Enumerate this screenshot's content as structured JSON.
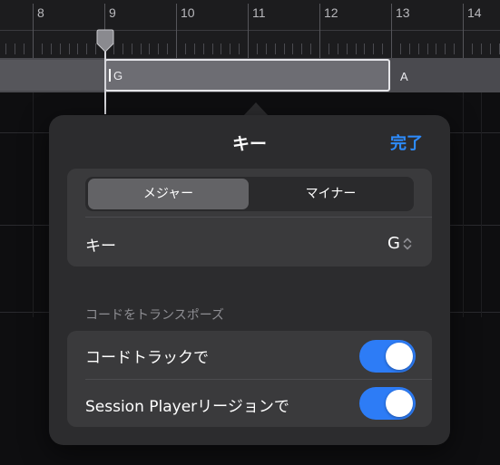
{
  "ruler": {
    "bar_numbers": [
      "8",
      "9",
      "10",
      "11",
      "12",
      "13",
      "14"
    ]
  },
  "chord_track": {
    "selected_chord": "G",
    "next_chord": "A"
  },
  "popover": {
    "title": "キー",
    "done_label": "完了",
    "mode_segment": {
      "options": [
        "メジャー",
        "マイナー"
      ],
      "selected": "メジャー"
    },
    "key_row": {
      "label": "キー",
      "value": "G"
    },
    "transpose_section": {
      "header": "コードをトランスポーズ",
      "rows": [
        {
          "label": "コードトラックで",
          "enabled": true
        },
        {
          "label": "Session Playerリージョンで",
          "enabled": true
        }
      ]
    }
  },
  "colors": {
    "accent": "#2d8cff",
    "toggle_on": "#2d7cf6",
    "popover_bg": "#2c2c2e",
    "group_bg": "#3a3a3c"
  }
}
